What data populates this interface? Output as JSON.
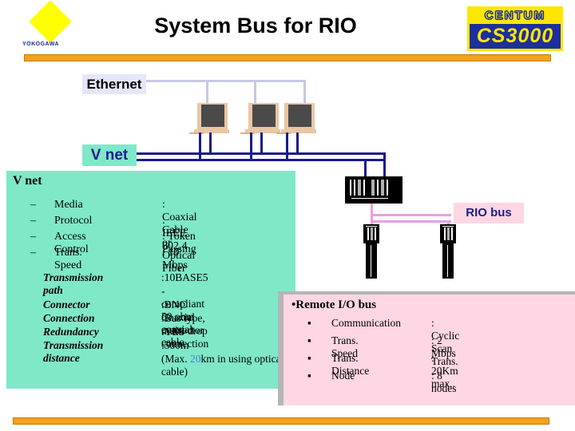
{
  "header": {
    "title": "System  Bus for RIO",
    "brand_logo": {
      "name": "YOKOGAWA",
      "icon": "yokogawa-diamond-icon"
    },
    "product_logo": {
      "top": "CENTUM",
      "bottom": "CS3000",
      "icon": "centum-cs3000-logo"
    }
  },
  "colors": {
    "accent_bar": "#f5a11b",
    "vnet_panel": "#7fe8c8",
    "rio_panel": "#ffd6e3",
    "ethernet_label": "#e6e6fa",
    "bus_navy": "#1a1a8c",
    "rio_bus_pink": "#e99fe0",
    "logo_yellow": "#ffe600",
    "logo_blue": "#1c2f9c"
  },
  "diagram": {
    "ethernet_label": "Ethernet",
    "vnet_label": "V net",
    "rio_bus_label": "RIO  bus",
    "stations": [
      {
        "name": "his-station-1"
      },
      {
        "name": "his-station-2"
      },
      {
        "name": "his-station-3"
      }
    ],
    "field_control_station": "fcs-unit",
    "nodes": [
      {
        "name": "node-unit-1"
      },
      {
        "name": "node-unit-2"
      }
    ]
  },
  "vnet_panel": {
    "heading": "V  net",
    "bullet": "–",
    "items": [
      {
        "key": "Media",
        "value": ": Coaxial Cable or Optical Fiber"
      },
      {
        "key": "Protocol",
        "value": ":  IEEE 802.4"
      },
      {
        "key": "Access Control",
        "value": ": Token Passing"
      },
      {
        "key": "Trans. Speed",
        "value": ": 10 Mbps"
      }
    ],
    "specs": [
      {
        "key": "Transmission path",
        "value": ":10BASE5"
      },
      {
        "key": "",
        "value": " -compliant 50 ohm coaxial cable"
      },
      {
        "key": "Connector",
        "value": ":BNC Coaxial connector"
      },
      {
        "key": "Connection",
        "value": ":Bus type, multi-drop connection"
      },
      {
        "key": "Redundancy",
        "value": ":YES"
      },
      {
        "key": "Transmission distance",
        "value": ":500m"
      }
    ],
    "spec_note_pre": "(Max. ",
    "spec_note_num": "20",
    "spec_note_post": "km in using optical cable)"
  },
  "rio_panel": {
    "heading": "Remote I/O bus",
    "heading_bullet": "•",
    "bullet": "▪",
    "items": [
      {
        "key": "Communication",
        "value": ": Cyclic Scan Trans."
      },
      {
        "key": "Trans. Speed",
        "value": ": 2 Mbps"
      },
      {
        "key": "Trans. Distance",
        "value": ": 20Km max.."
      },
      {
        "key": "Node",
        "value": ": 8 nodes"
      }
    ]
  }
}
